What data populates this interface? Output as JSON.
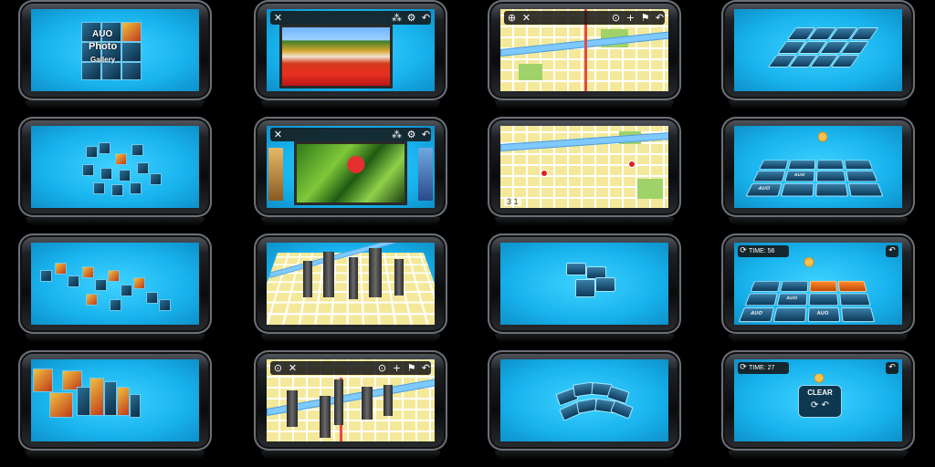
{
  "panels": {
    "gallery_cube": {
      "logo_text": "AUO",
      "title_line1": "Photo",
      "title_line2": "Gallery"
    },
    "photo_viewer": {
      "toolbar": {
        "close_icon": "✕",
        "grid_icon": "⁂",
        "settings_icon": "⚙",
        "back_icon": "↶"
      }
    },
    "map_view": {
      "toolbar": {
        "zoom_icon": "⊕",
        "close_icon": "✕",
        "locate_icon": "⊙",
        "plus_icon": "+",
        "flag_icon": "⚑",
        "back_icon": "↶"
      },
      "scale_text": "3 1"
    },
    "game_board": {
      "tile_label": "AUO",
      "time_label_1": "TIME: 56",
      "time_label_2": "TIME: 27",
      "clear_text": "CLEAR",
      "refresh_icon": "⟳",
      "back_icon": "↶"
    }
  },
  "colors": {
    "screen": "#18b3ee",
    "tile": "#0d3a5a",
    "tile_highlight": "#ff8a2a",
    "map_base": "#f4e99a",
    "map_route": "#e64848"
  }
}
